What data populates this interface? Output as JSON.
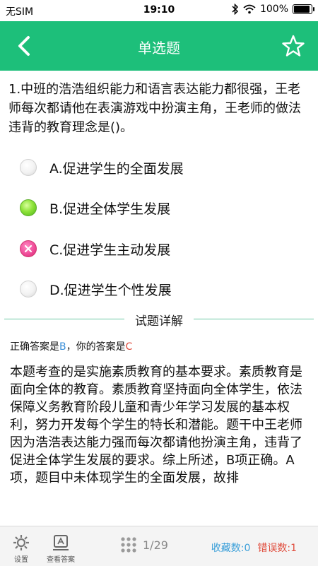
{
  "status_bar": {
    "carrier": "无SIM",
    "time": "19:10",
    "battery": "100%",
    "battery_level": 1.0
  },
  "nav": {
    "title": "单选题",
    "back_icon": "chevron-left-icon",
    "favorite_icon": "star-outline-icon"
  },
  "question": {
    "text": "1.中班的浩浩组织能力和语言表达能力都很强，王老师每次都请他在表演游戏中扮演主角，王老师的做法违背的教育理念是()。"
  },
  "options": [
    {
      "label": "A.促进学生的全面发展",
      "state": "empty"
    },
    {
      "label": "B.促进全体学生发展",
      "state": "correct"
    },
    {
      "label": "C.促进学生主动发展",
      "state": "wrong"
    },
    {
      "label": "D.促进学生个性发展",
      "state": "empty"
    }
  ],
  "explanation": {
    "heading": "试题详解",
    "correct_prefix": "正确答案是",
    "correct_value": "B",
    "separator": "，你的答案是",
    "user_value": "C",
    "body": "本题考查的是实施素质教育的基本要求。素质教育是面向全体的教育。素质教育坚持面向全体学生，依法保障义务教育阶段儿童和青少年学习发展的基本权利，努力开发每个学生的特长和潜能。题干中王老师因为浩浩表达能力强而每次都请他扮演主角，违背了促进全体学生发展的要求。综上所述，B项正确。A项，题目中未体现学生的全面发展，故排"
  },
  "bottom_bar": {
    "settings_label": "设置",
    "view_answer_label": "查看答案",
    "page": "1/29",
    "favorites": "收藏数:0",
    "errors": "错误数:1"
  },
  "colors": {
    "primary": "#1dbf7a",
    "correct": "#7ed63a",
    "wrong": "#f04e9b",
    "blue": "#3a8fd9",
    "red": "#e04c3c"
  }
}
